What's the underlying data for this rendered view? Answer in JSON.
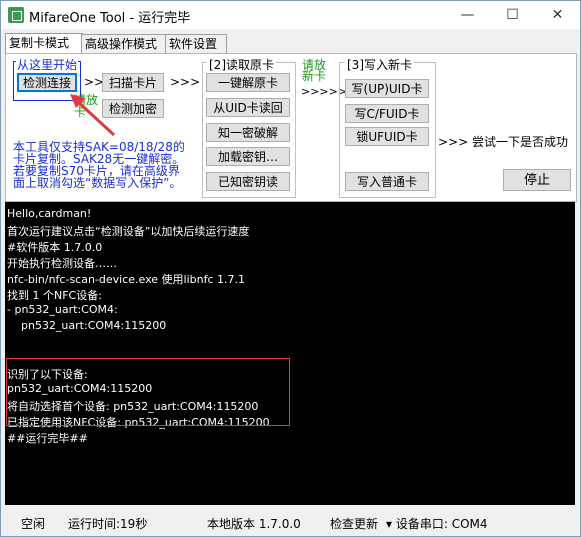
{
  "window": {
    "title": "MifareOne Tool - 运行完毕",
    "min": "—",
    "max": "☐",
    "close": "✕"
  },
  "tabs": [
    "复制卡模式",
    "高级操作模式",
    "软件设置"
  ],
  "panel": {
    "start_label": "从这里开始",
    "connect_btn": "检测连接",
    "arrow1": ">>",
    "scan_btn": "扫描卡片",
    "arrow2": ">>>",
    "place_card": "请放卡",
    "check_enc_btn": "检测加密",
    "read_group_title": "[2]读取原卡",
    "decrypt_btn": "一键解原卡",
    "read_uid_btn": "从UID卡读回",
    "one_key_btn": "知一密破解",
    "load_key_btn": "加载密钥…",
    "known_key_btn": "已知密钥读",
    "place_new_card": "请放新卡",
    "arrow3": ">>>>>",
    "write_group_title": "[3]写入新卡",
    "write_uid_btn": "写(UP)UID卡",
    "write_fuid_btn": "写C/FUID卡",
    "lock_ufuid_btn": "锁UFUID卡",
    "write_normal_btn": "写入普通卡",
    "try_label": ">>> 尝试一下是否成功",
    "stop_btn": "停止",
    "notice_lines": [
      "本工具仅支持SAK=08/18/28的",
      "卡片复制。SAK28无一键解密。",
      "若要复制S70卡片，请在高级界",
      "面上取消勾选“数据写入保护”。"
    ]
  },
  "console": [
    "Hello,cardman!",
    "首次运行建议点击“检测设备”以加快后续运行速度",
    "#软件版本 1.7.0.0",
    "开始执行检测设备……",
    "nfc-bin/nfc-scan-device.exe 使用libnfc 1.7.1",
    "找到 1 个NFC设备:",
    "- pn532_uart:COM4:",
    "    pn532_uart:COM4:115200",
    "",
    "识别了以下设备:",
    "pn532_uart:COM4:115200",
    "将自动选择首个设备: pn532_uart:COM4:115200",
    "已指定使用该NFC设备: pn532_uart:COM4:115200",
    "##运行完毕##"
  ],
  "status": {
    "idle": "空闲",
    "runtime": "运行时间:19秒",
    "version": "本地版本 1.7.0.0",
    "check_update": "检查更新",
    "port": "▾ 设备串口: COM4"
  },
  "colors": {
    "highlight_red": "#e0393e",
    "guide_red": "#e0393e",
    "green": "#1b9b1b",
    "blue": "#1a2fd8"
  }
}
